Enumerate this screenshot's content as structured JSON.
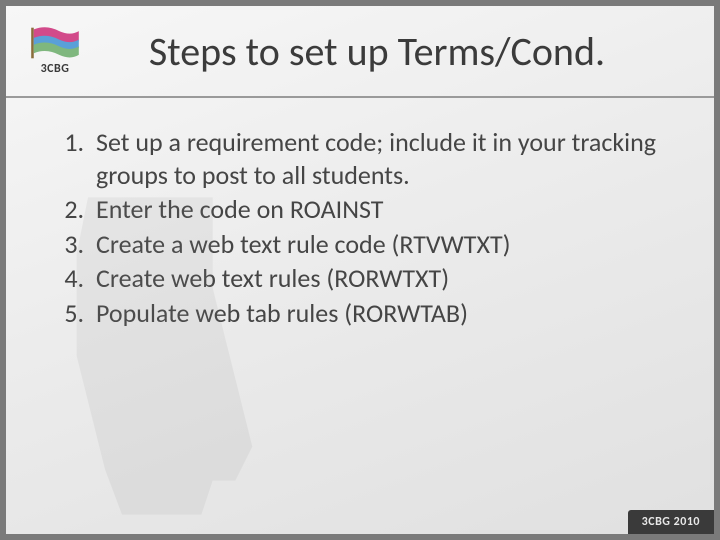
{
  "logo": {
    "text": "3CBG"
  },
  "title": "Steps to set up Terms/Cond.",
  "steps": [
    "Set up a requirement code; include it in your tracking groups to post to all students.",
    "Enter the code on ROAINST",
    "Create a web text rule code (RTVWTXT)",
    "Create web text rules (RORWTXT)",
    "Populate web tab rules (RORWTAB)"
  ],
  "footer": "3CBG 2010"
}
